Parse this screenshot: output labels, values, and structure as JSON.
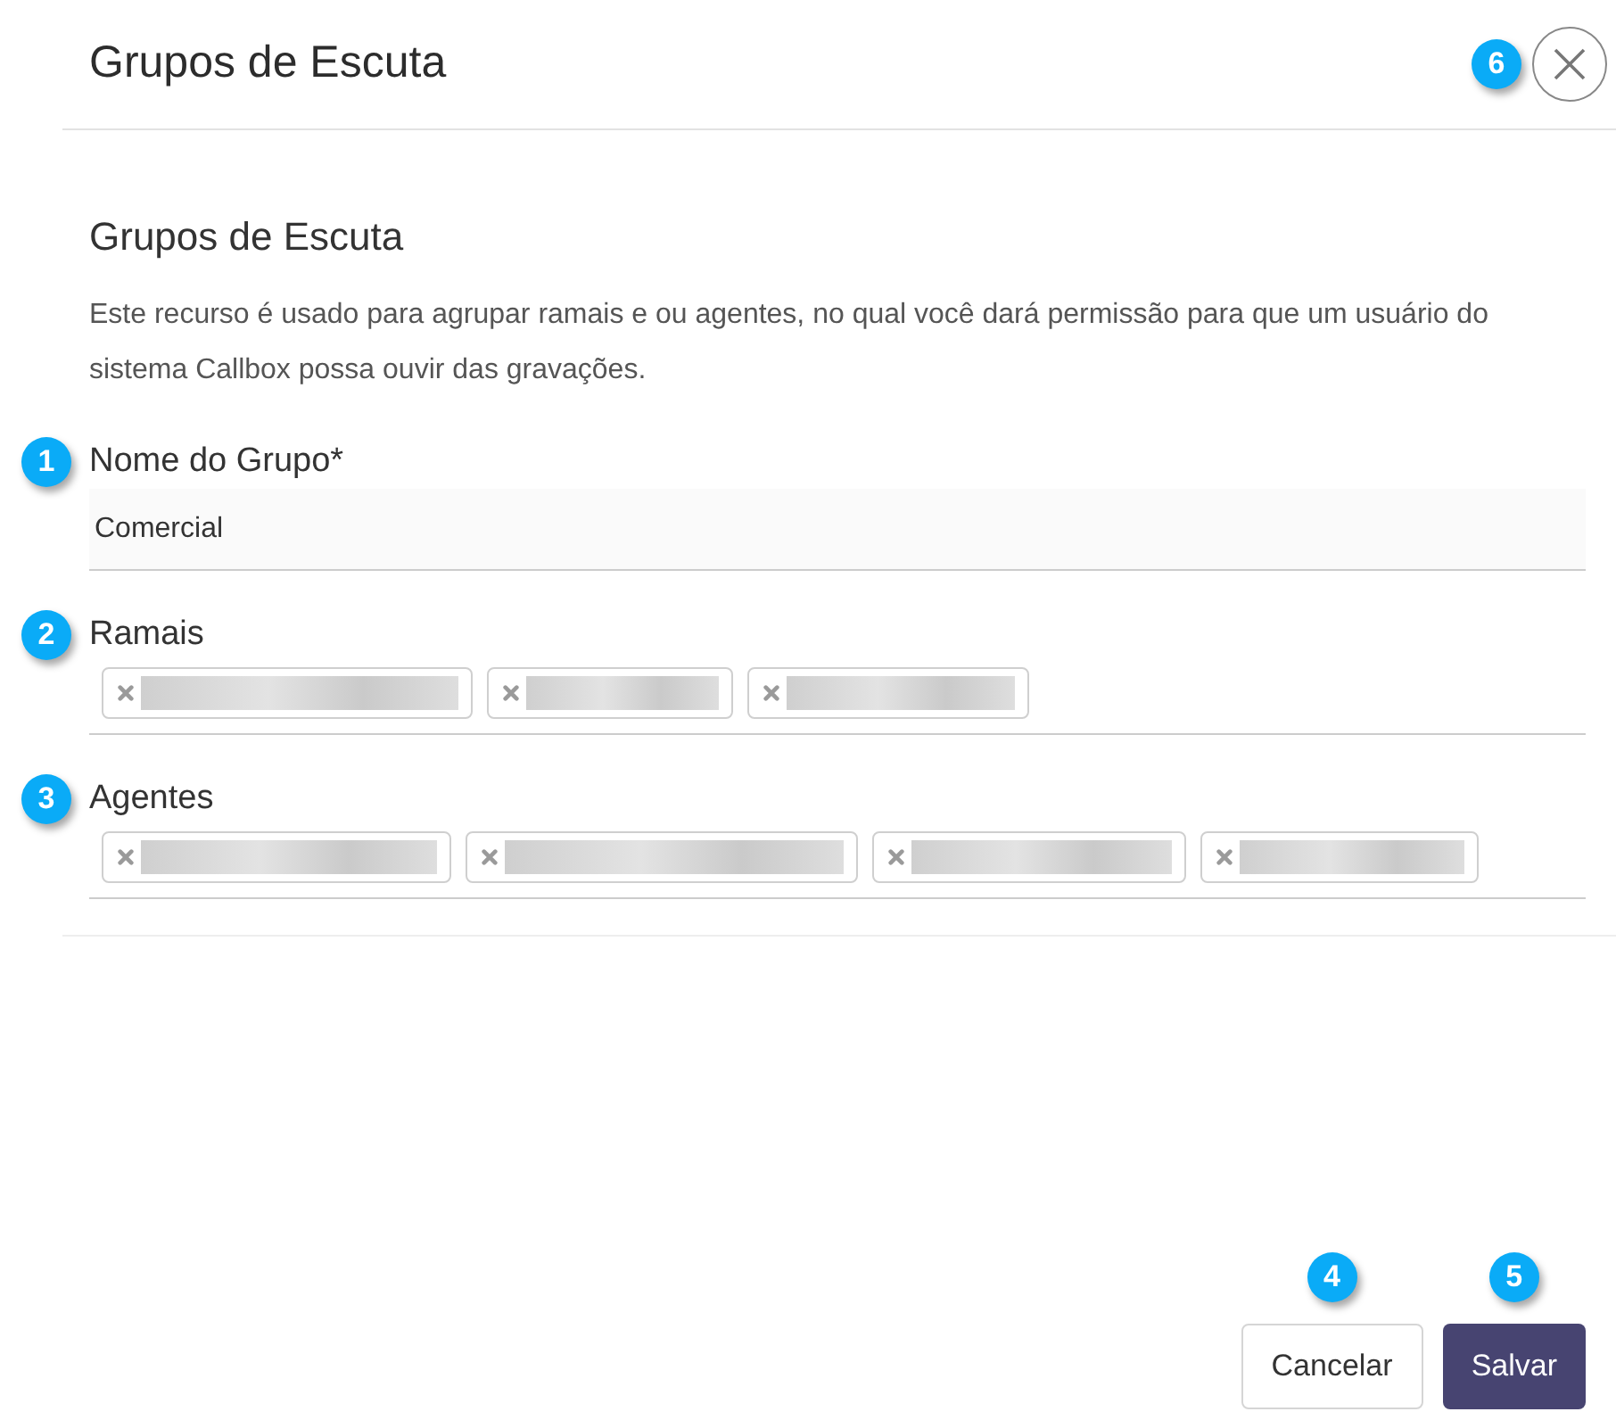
{
  "dialog": {
    "title": "Grupos de Escuta",
    "close_callout": "6"
  },
  "section": {
    "title": "Grupos de Escuta",
    "description": "Este recurso é usado para agrupar ramais e ou agentes, no qual você dará permissão para que um usuário do sistema Callbox possa ouvir das gravações."
  },
  "fields": [
    {
      "kind": "text",
      "callout": "1",
      "label": "Nome do Grupo*",
      "value": "Comercial"
    },
    {
      "kind": "tags",
      "callout": "2",
      "label": "Ramais",
      "tags": [
        {
          "kind": "redacted"
        },
        {
          "kind": "redacted"
        },
        {
          "kind": "redacted"
        }
      ]
    },
    {
      "kind": "tags",
      "callout": "3",
      "label": "Agentes",
      "tags": [
        {
          "kind": "redacted"
        },
        {
          "kind": "redacted"
        },
        {
          "kind": "redacted"
        },
        {
          "kind": "redacted"
        }
      ]
    }
  ],
  "buttons": [
    {
      "kind": "secondary",
      "label": "Cancelar",
      "callout": "4"
    },
    {
      "kind": "primary",
      "label": "Salvar",
      "callout": "5"
    }
  ]
}
